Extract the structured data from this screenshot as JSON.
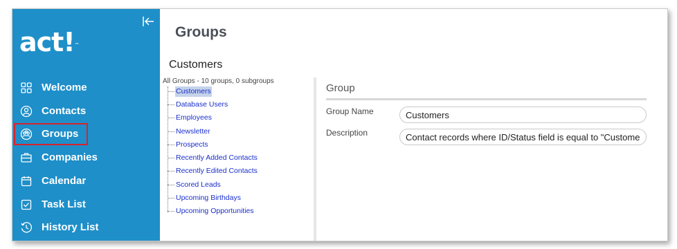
{
  "app": {
    "logo_text": "act!",
    "logo_mark": "™",
    "brand_color": "#1e8fc9"
  },
  "sidebar": {
    "items": [
      {
        "label": "Welcome",
        "icon": "grid-icon"
      },
      {
        "label": "Contacts",
        "icon": "contact-icon"
      },
      {
        "label": "Groups",
        "icon": "groups-icon",
        "selected": true
      },
      {
        "label": "Companies",
        "icon": "briefcase-icon"
      },
      {
        "label": "Calendar",
        "icon": "calendar-icon"
      },
      {
        "label": "Task List",
        "icon": "task-icon"
      },
      {
        "label": "History List",
        "icon": "history-icon"
      }
    ]
  },
  "main": {
    "page_title": "Groups",
    "section_title": "Customers",
    "tree": {
      "header": "All Groups - 10 groups, 0 subgroups",
      "items": [
        "Customers",
        "Database Users",
        "Employees",
        "Newsletter",
        "Prospects",
        "Recently Added Contacts",
        "Recently Edited Contacts",
        "Scored Leads",
        "Upcoming Birthdays",
        "Upcoming Opportunities"
      ],
      "selected_index": 0
    },
    "detail": {
      "title": "Group",
      "group_name_label": "Group Name",
      "group_name_value": "Customers",
      "description_label": "Description",
      "description_value": "Contact records where ID/Status field is equal to \"Customer\""
    }
  }
}
